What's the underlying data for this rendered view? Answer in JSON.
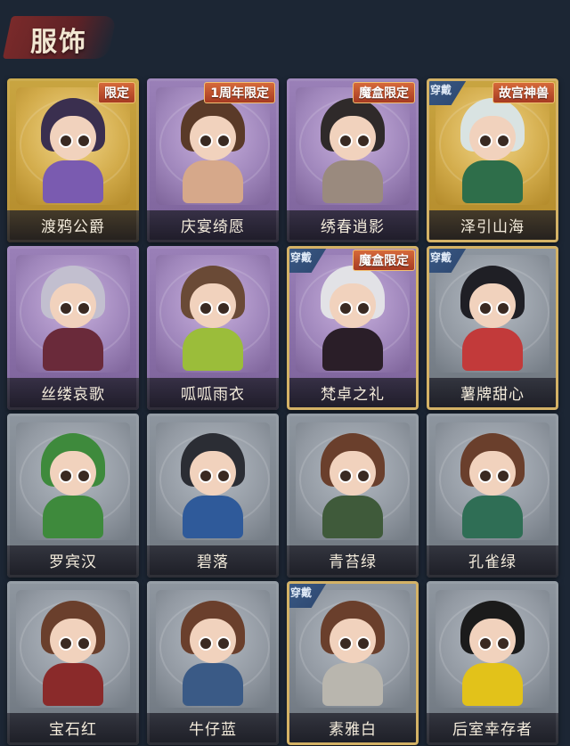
{
  "header": {
    "title": "服饰"
  },
  "cards": [
    {
      "name": "渡鸦公爵",
      "tag": "限定",
      "worn": false,
      "rarity": "gold",
      "colors": {
        "hair": "#3a2f4f",
        "body": "#7a5bb0"
      }
    },
    {
      "name": "庆宴绮愿",
      "tag": "1周年限定",
      "worn": false,
      "rarity": "purple",
      "colors": {
        "hair": "#5a3a28",
        "body": "#d6a88a"
      }
    },
    {
      "name": "绣春逍影",
      "tag": "魔盒限定",
      "worn": false,
      "rarity": "purple",
      "colors": {
        "hair": "#2f2a2a",
        "body": "#9a8a7e"
      }
    },
    {
      "name": "泽引山海",
      "tag": "故宫神兽",
      "worn": true,
      "rarity": "gold",
      "colors": {
        "hair": "#d9e3e2",
        "body": "#2e6e4a"
      }
    },
    {
      "name": "丝缕哀歌",
      "tag": "",
      "worn": false,
      "rarity": "purple",
      "colors": {
        "hair": "#c2bfcf",
        "body": "#6a2a3a"
      }
    },
    {
      "name": "呱呱雨衣",
      "tag": "",
      "worn": false,
      "rarity": "purple",
      "colors": {
        "hair": "#6a4a36",
        "body": "#9bbd3a"
      }
    },
    {
      "name": "梵卓之礼",
      "tag": "魔盒限定",
      "worn": true,
      "rarity": "purple",
      "colors": {
        "hair": "#e2e2e6",
        "body": "#2a1e28"
      }
    },
    {
      "name": "薯牌甜心",
      "tag": "",
      "worn": true,
      "rarity": "gray",
      "colors": {
        "hair": "#1f1f25",
        "body": "#c23a3a"
      }
    },
    {
      "name": "罗宾汉",
      "tag": "",
      "worn": false,
      "rarity": "gray",
      "colors": {
        "hair": "#3e8a3c",
        "body": "#3e8a3c"
      }
    },
    {
      "name": "碧落",
      "tag": "",
      "worn": false,
      "rarity": "gray",
      "colors": {
        "hair": "#2b2d34",
        "body": "#2f5a9a"
      }
    },
    {
      "name": "青苔绿",
      "tag": "",
      "worn": false,
      "rarity": "gray",
      "colors": {
        "hair": "#6a3f2c",
        "body": "#3f5a3a"
      }
    },
    {
      "name": "孔雀绿",
      "tag": "",
      "worn": false,
      "rarity": "gray",
      "colors": {
        "hair": "#6a3f2c",
        "body": "#2f6e55"
      }
    },
    {
      "name": "宝石红",
      "tag": "",
      "worn": false,
      "rarity": "gray",
      "colors": {
        "hair": "#6a3f2c",
        "body": "#8a2a2a"
      }
    },
    {
      "name": "牛仔蓝",
      "tag": "",
      "worn": false,
      "rarity": "gray",
      "colors": {
        "hair": "#6a3f2c",
        "body": "#3a5a86"
      }
    },
    {
      "name": "素雅白",
      "tag": "",
      "worn": true,
      "rarity": "gray",
      "colors": {
        "hair": "#6a3f2c",
        "body": "#b9b6ae"
      }
    },
    {
      "name": "后室幸存者",
      "tag": "",
      "worn": false,
      "rarity": "gray",
      "colors": {
        "hair": "#1b1b1b",
        "body": "#e2c21a"
      }
    }
  ],
  "worn_label": "穿戴"
}
